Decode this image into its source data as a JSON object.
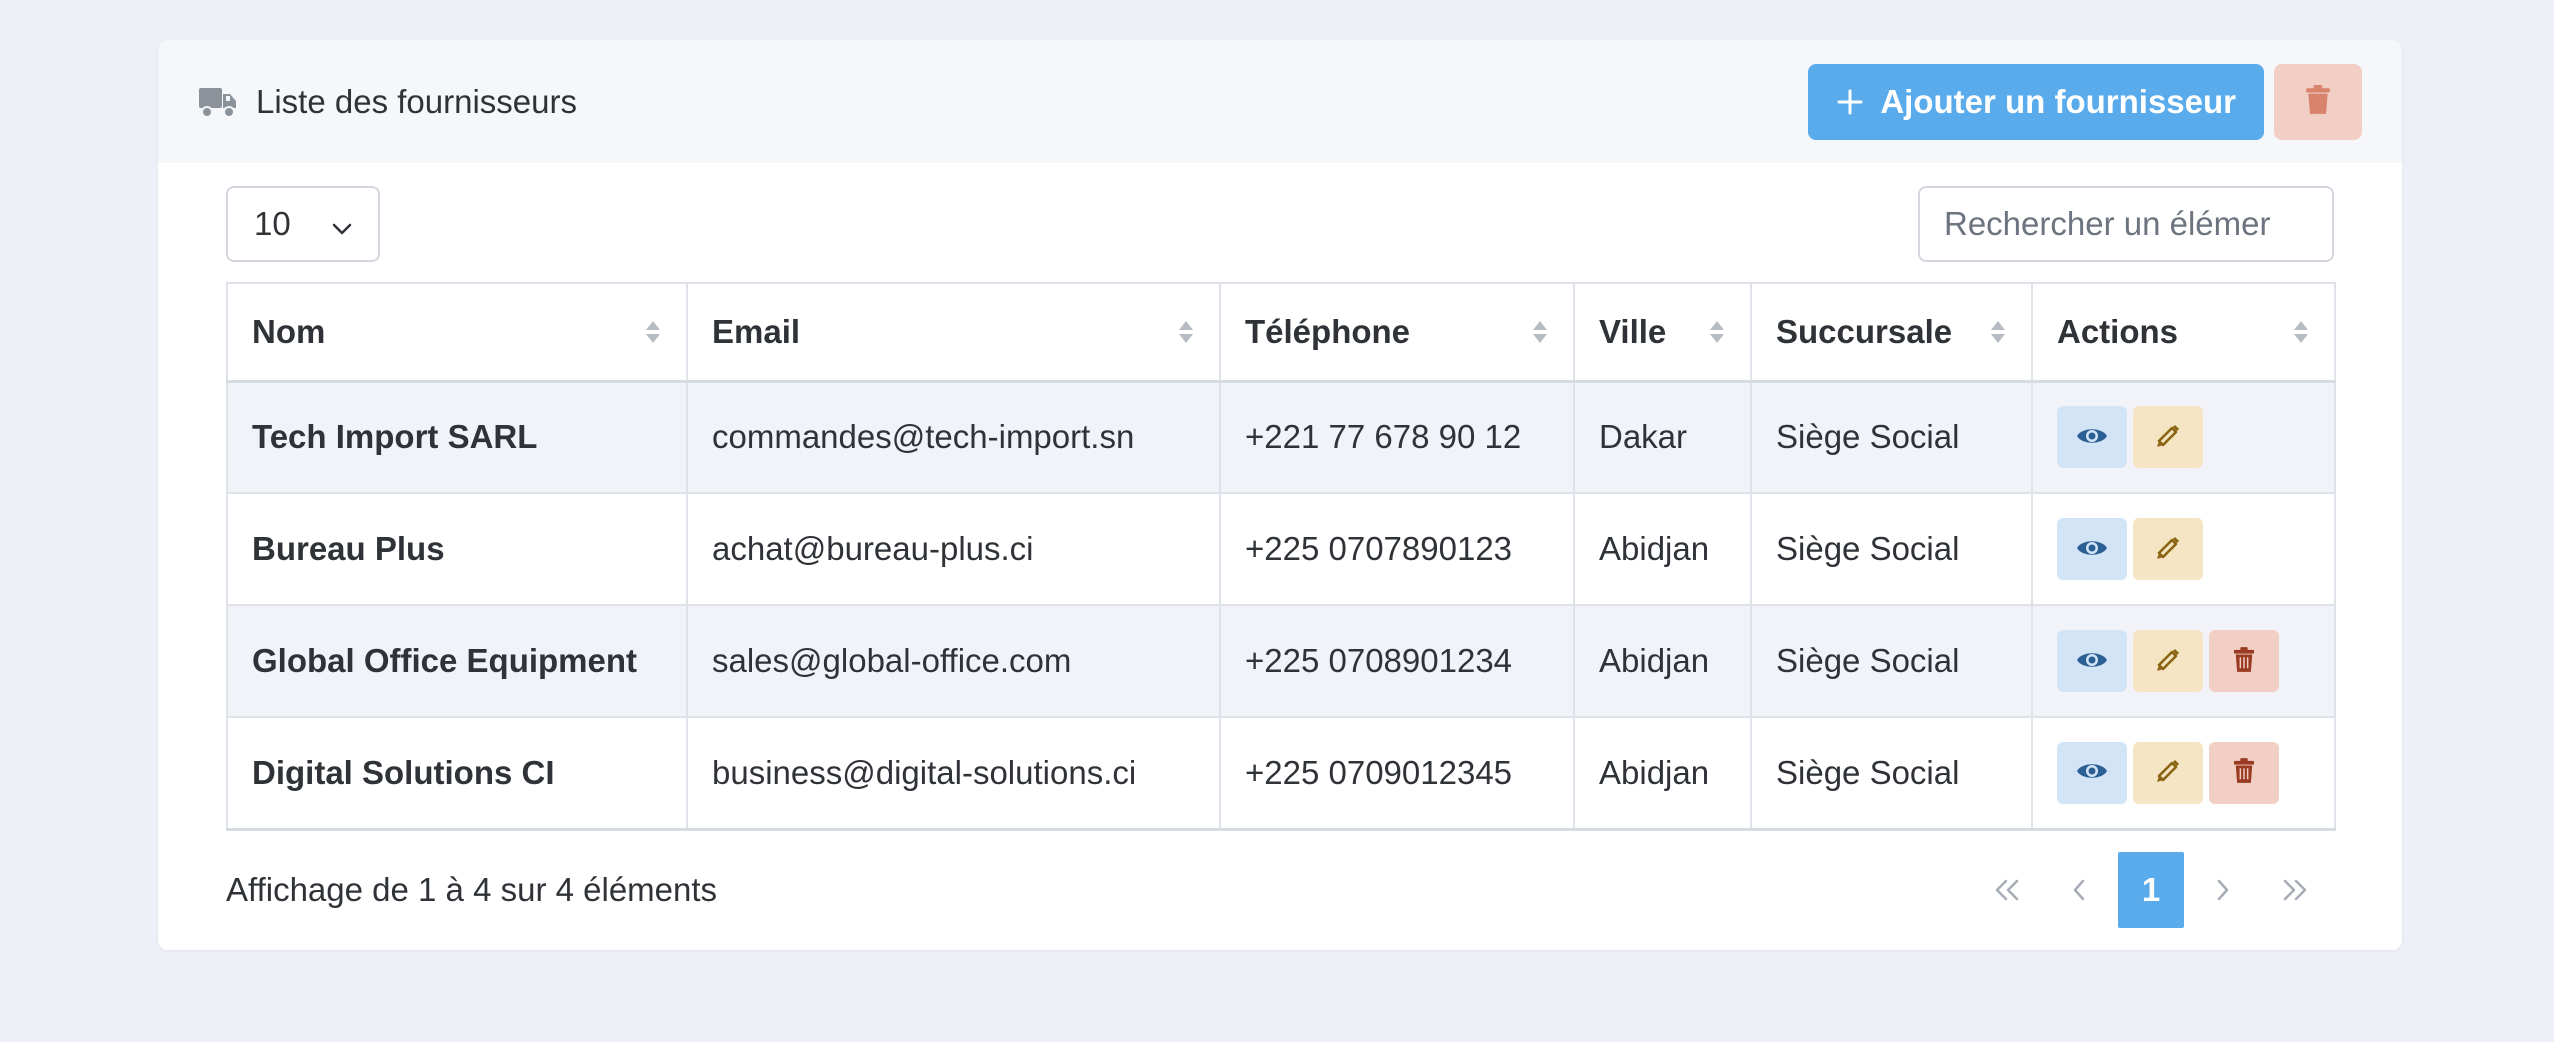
{
  "header": {
    "title": "Liste des fournisseurs",
    "title_icon": "truck-icon",
    "add_button_label": "Ajouter un fournisseur",
    "add_button_icon": "plus-icon",
    "bulk_delete_icon": "trash-icon"
  },
  "controls": {
    "page_size": "10",
    "search_placeholder": "Rechercher un élémer"
  },
  "table": {
    "columns": [
      "Nom",
      "Email",
      "Téléphone",
      "Ville",
      "Succursale",
      "Actions"
    ],
    "rows": [
      {
        "nom": "Tech Import SARL",
        "email": "commandes@tech-import.sn",
        "telephone": "+221 77 678 90 12",
        "ville": "Dakar",
        "succursale": "Siège Social",
        "actions": [
          "view",
          "edit"
        ]
      },
      {
        "nom": "Bureau Plus",
        "email": "achat@bureau-plus.ci",
        "telephone": "+225 0707890123",
        "ville": "Abidjan",
        "succursale": "Siège Social",
        "actions": [
          "view",
          "edit"
        ]
      },
      {
        "nom": "Global Office Equipment",
        "email": "sales@global-office.com",
        "telephone": "+225 0708901234",
        "ville": "Abidjan",
        "succursale": "Siège Social",
        "actions": [
          "view",
          "edit",
          "delete"
        ]
      },
      {
        "nom": "Digital Solutions CI",
        "email": "business@digital-solutions.ci",
        "telephone": "+225 0709012345",
        "ville": "Abidjan",
        "succursale": "Siège Social",
        "actions": [
          "view",
          "edit",
          "delete"
        ]
      }
    ]
  },
  "footer": {
    "info": "Affichage de 1 à 4 sur 4 éléments",
    "current_page": "1"
  },
  "colors": {
    "primary": "#5aabec",
    "view_bg": "#d3e4f6",
    "view_icon": "#2c5f93",
    "edit_bg": "#f5e5c4",
    "edit_icon": "#8a6410",
    "delete_bg": "#f2cfc5",
    "delete_icon": "#9a3a22"
  }
}
